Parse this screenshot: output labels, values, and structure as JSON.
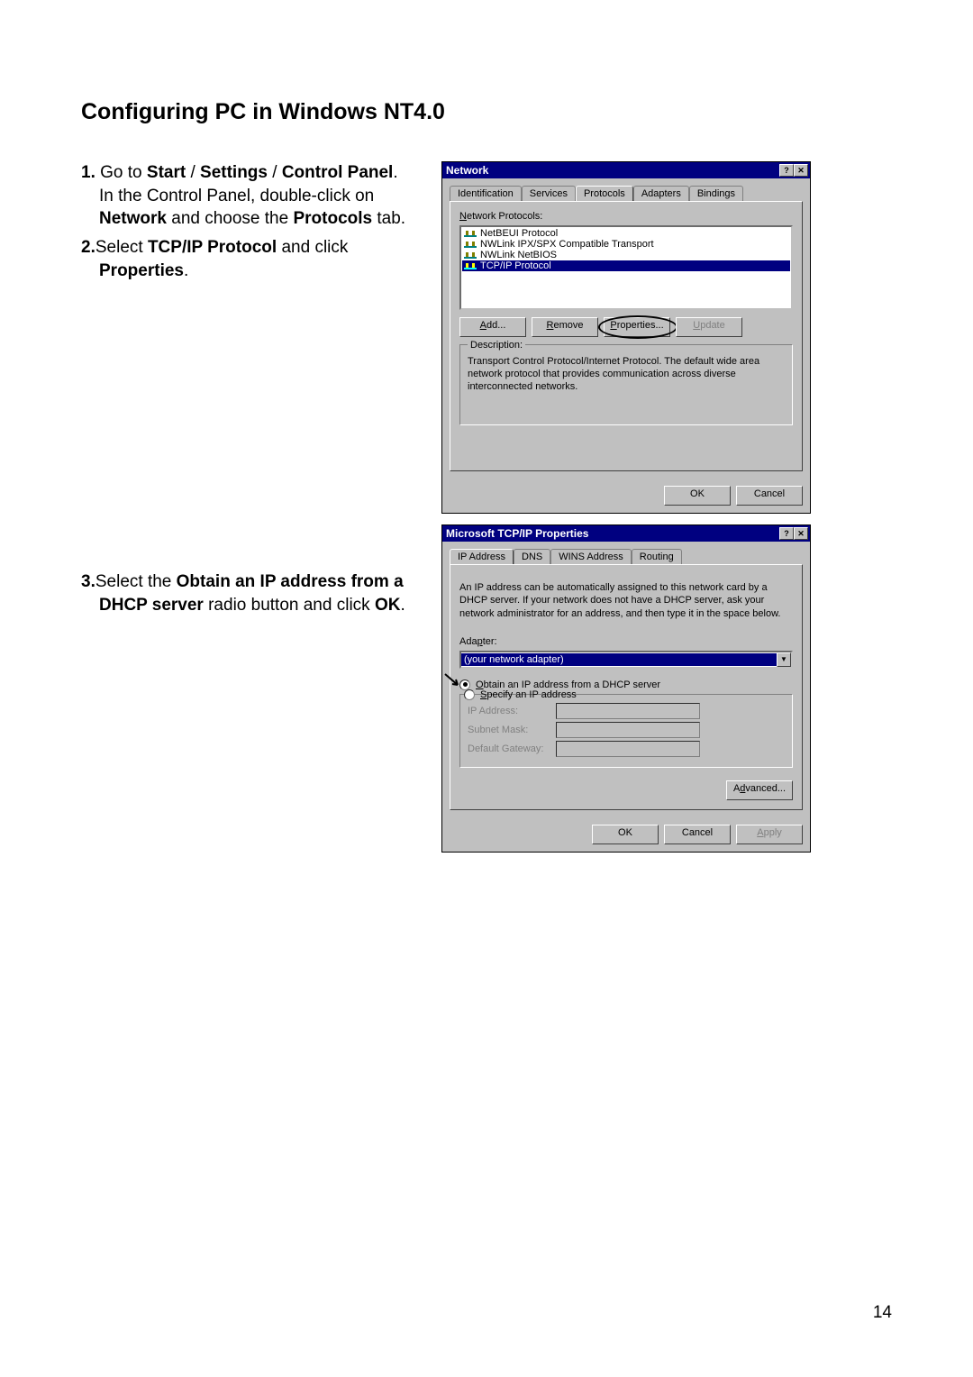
{
  "page": {
    "title": "Configuring PC in Windows NT4.0",
    "page_number": "14"
  },
  "steps": {
    "s1": {
      "num": "1.",
      "pre": " Go to ",
      "b1": "Start",
      "sep1": " / ",
      "b2": "Settings",
      "sep2": " / ",
      "b3": "Control Panel",
      "post1": ". In the Control Panel, double-click on ",
      "b4": "Network",
      "post2": " and choose the ",
      "b5": "Protocols",
      "post3": " tab."
    },
    "s2": {
      "num": "2.",
      "pre": "Select ",
      "b1": "TCP/IP Protocol",
      "mid": " and click ",
      "b2": "Properties",
      "post": "."
    },
    "s3": {
      "num": "3.",
      "pre": "Select the ",
      "b1": "Obtain an IP address from a DHCP server",
      "mid": " radio button and click ",
      "b2": "OK",
      "post": "."
    }
  },
  "dlg_network": {
    "title": "Network",
    "tabs": [
      "Identification",
      "Services",
      "Protocols",
      "Adapters",
      "Bindings"
    ],
    "protocols_label": "Network Protocols:",
    "protocols_label_u": "N",
    "protocols": [
      "NetBEUI Protocol",
      "NWLink IPX/SPX Compatible Transport",
      "NWLink NetBIOS",
      "TCP/IP Protocol"
    ],
    "buttons": {
      "add": "Add...",
      "remove": "Remove",
      "properties": "Properties...",
      "update": "Update"
    },
    "desc_label": "Description:",
    "desc_text": "Transport Control Protocol/Internet Protocol. The default wide area network protocol that provides communication across diverse interconnected networks.",
    "ok": "OK",
    "cancel": "Cancel"
  },
  "dlg_tcpip": {
    "title": "Microsoft TCP/IP Properties",
    "tabs": [
      "IP Address",
      "DNS",
      "WINS Address",
      "Routing"
    ],
    "info": "An IP address can be automatically assigned to this network card by a DHCP server. If your network does not have a DHCP server, ask your network administrator for an address, and then type it in the space below.",
    "adapter_label": "Adapter:",
    "adapter_value": "(your network adapter)",
    "radio_obtain": "Obtain an IP address from a DHCP server",
    "radio_specify": "Specify an IP address",
    "ip_label": "IP Address:",
    "subnet_label": "Subnet Mask:",
    "gateway_label": "Default Gateway:",
    "advanced": "Advanced...",
    "ok": "OK",
    "cancel": "Cancel",
    "apply": "Apply"
  }
}
